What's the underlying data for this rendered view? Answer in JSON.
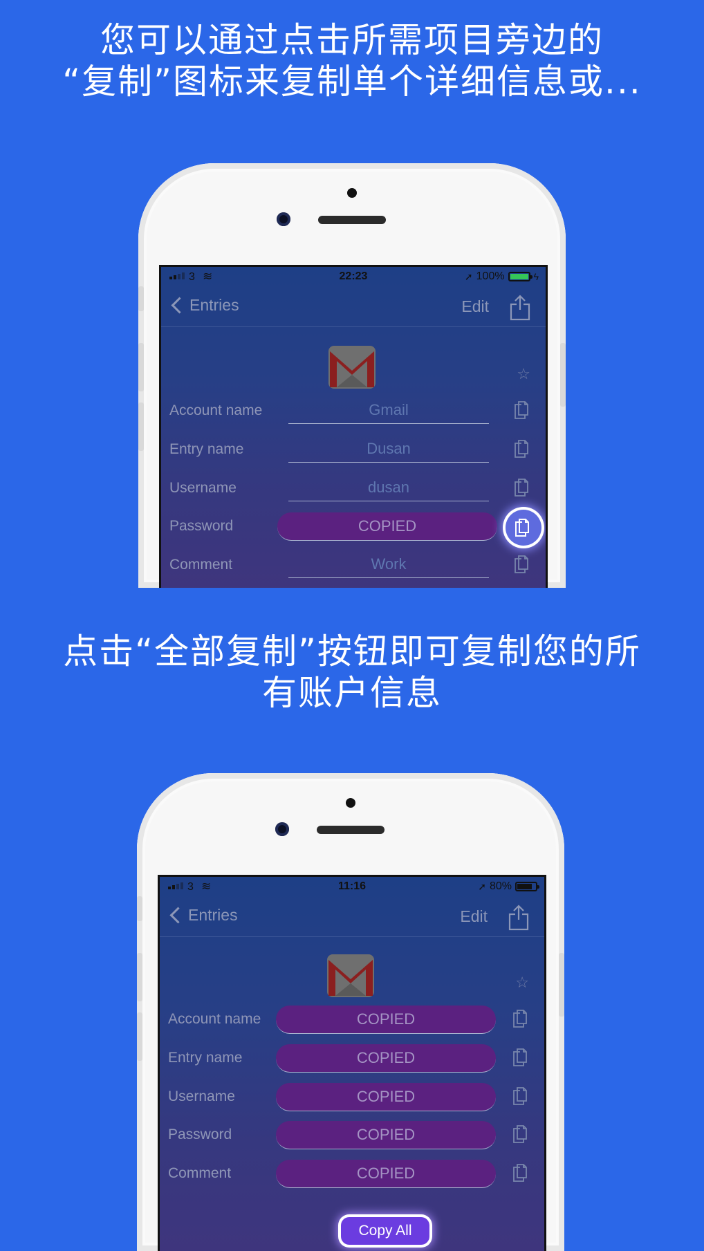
{
  "headline1": {
    "line1": "您可以通过点击所需项目旁边的",
    "line2": "“复制”图标来复制单个详细信息或..."
  },
  "headline2": {
    "line1": "点击“全部复制”按钮即可复制您的所",
    "line2": "有账户信息"
  },
  "colors": {
    "background": "#2B67E8",
    "copied_pill": "#5B2180",
    "copy_all_button": "#6B3CE0"
  },
  "screen1": {
    "status": {
      "carrier": "3",
      "time": "22:23",
      "battery": "100%"
    },
    "nav": {
      "back": "Entries",
      "edit": "Edit"
    },
    "rows": [
      {
        "label": "Account name",
        "value": "Gmail"
      },
      {
        "label": "Entry name",
        "value": "Dusan"
      },
      {
        "label": "Username",
        "value": "dusan"
      },
      {
        "label": "Password",
        "value": "COPIED"
      },
      {
        "label": "Comment",
        "value": "Work"
      }
    ]
  },
  "screen2": {
    "status": {
      "carrier": "3",
      "time": "11:16",
      "battery": "80%"
    },
    "nav": {
      "back": "Entries",
      "edit": "Edit"
    },
    "rows": [
      {
        "label": "Account name",
        "value": "COPIED"
      },
      {
        "label": "Entry name",
        "value": "COPIED"
      },
      {
        "label": "Username",
        "value": "COPIED"
      },
      {
        "label": "Password",
        "value": "COPIED"
      },
      {
        "label": "Comment",
        "value": "COPIED"
      }
    ],
    "copy_all": "Copy All"
  }
}
